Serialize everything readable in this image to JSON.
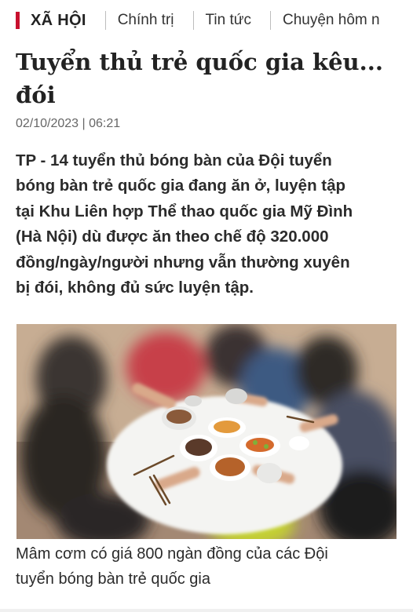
{
  "nav": {
    "section": "XÃ HỘI",
    "items": [
      "Chính trị",
      "Tin tức",
      "Chuyện hôm n"
    ]
  },
  "article": {
    "title_lines": [
      "Tuyển thủ trẻ quốc gia kêu...",
      "đói"
    ],
    "date": "02/10/2023 | 06:21",
    "sapo_lines": [
      "TP - 14 tuyển thủ bóng bàn của Đội tuyển",
      "bóng bàn trẻ quốc gia đang ăn ở, luyện tập",
      "tại Khu Liên hợp Thể thao quốc gia Mỹ Đình",
      "(Hà Nội) dù được ăn theo chế độ 320.000",
      "đồng/ngày/người nhưng vẫn thường xuyên",
      "bị đói, không đủ sức luyện tập."
    ],
    "caption_lines": [
      "Mâm cơm có giá 800 ngàn đồng của các Đội",
      "tuyển bóng bàn trẻ quốc gia"
    ]
  },
  "colors": {
    "accent": "#c8102e",
    "table": "#f4f4f2",
    "background": "#ffffff"
  }
}
